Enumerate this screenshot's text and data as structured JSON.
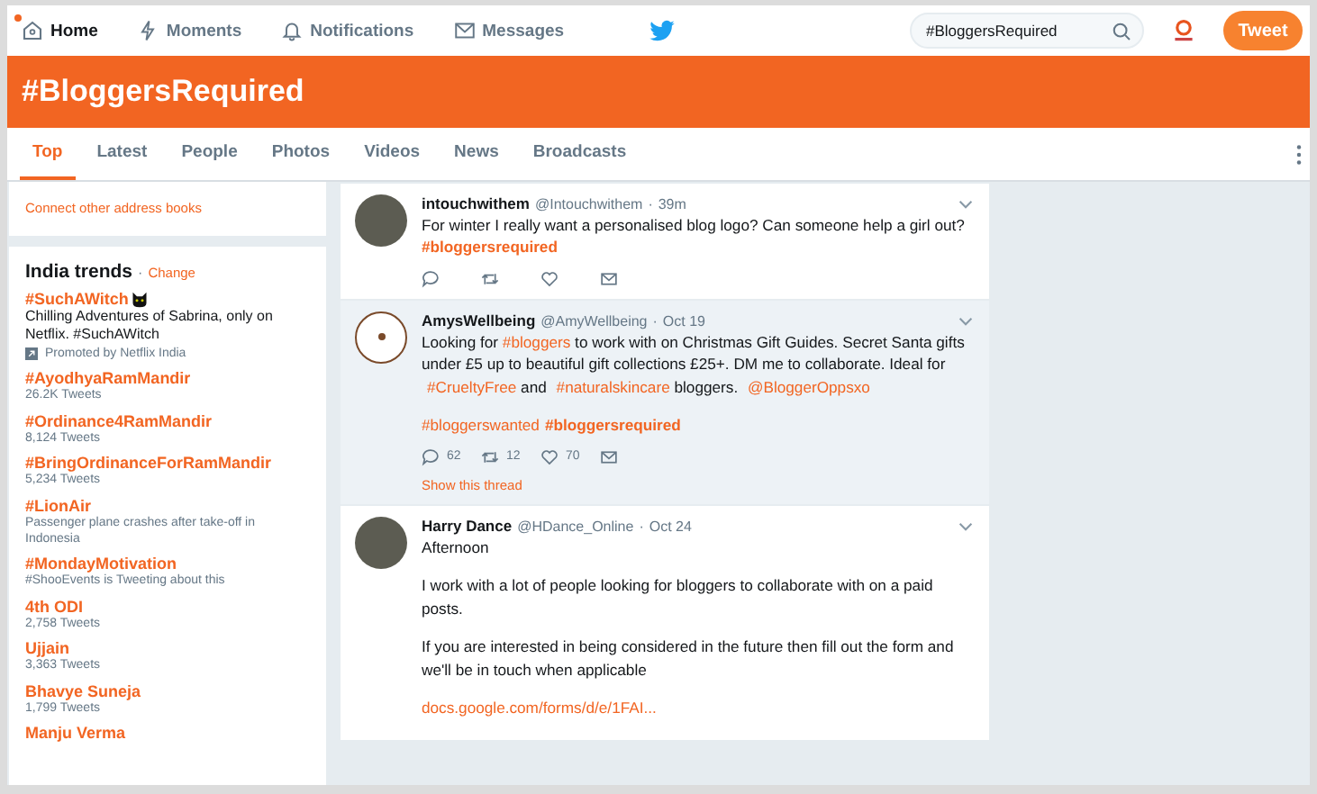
{
  "nav": {
    "items": [
      {
        "label": "Home",
        "selected": true,
        "dot": true
      },
      {
        "label": "Moments",
        "selected": false,
        "dot": false
      },
      {
        "label": "Notifications",
        "selected": false,
        "dot": false
      },
      {
        "label": "Messages",
        "selected": false,
        "dot": false
      }
    ],
    "search": {
      "value": "#BloggersRequired"
    },
    "tweet_button": "Tweet"
  },
  "banner": {
    "title": "#BloggersRequired"
  },
  "tabs": [
    {
      "label": "Top",
      "selected": true
    },
    {
      "label": "Latest",
      "selected": false
    },
    {
      "label": "People",
      "selected": false
    },
    {
      "label": "Photos",
      "selected": false
    },
    {
      "label": "Videos",
      "selected": false
    },
    {
      "label": "News",
      "selected": false
    },
    {
      "label": "Broadcasts",
      "selected": false
    }
  ],
  "sidebar": {
    "connect_link": "Connect other address books",
    "trends_title": "India trends",
    "separator": "·",
    "change_link": "Change",
    "trends": [
      {
        "kind": "promoted",
        "name": "#SuchAWitch",
        "description": "Chilling Adventures of Sabrina, only on Netflix. #SuchAWitch",
        "meta": "Promoted by Netflix India"
      },
      {
        "kind": "count",
        "name": "#AyodhyaRamMandir",
        "meta": "26.2K Tweets"
      },
      {
        "kind": "count",
        "name": "#Ordinance4RamMandir",
        "meta": "8,124 Tweets"
      },
      {
        "kind": "count",
        "name": "#BringOrdinanceForRamMandir",
        "meta": "5,234 Tweets"
      },
      {
        "kind": "count",
        "name": "#LionAir",
        "meta": "Passenger plane crashes after take-off in Indonesia"
      },
      {
        "kind": "count",
        "name": "#MondayMotivation",
        "meta": "#ShooEvents is Tweeting about this"
      },
      {
        "kind": "count",
        "name": "4th ODI",
        "meta": "2,758 Tweets"
      },
      {
        "kind": "count",
        "name": "Ujjain",
        "meta": "3,363 Tweets"
      },
      {
        "kind": "count",
        "name": "Bhavye Suneja",
        "meta": "1,799 Tweets"
      },
      {
        "kind": "count",
        "name": "Manju Verma"
      }
    ]
  },
  "tweets": [
    {
      "name": "intouchwithem",
      "handle": "@Intouchwithem",
      "separator": "·",
      "time": "39m",
      "highlighted": false,
      "paragraphs": [
        [
          {
            "kind": "plain",
            "text": "For winter I really want a personalised blog logo? Can someone help a girl out? "
          },
          {
            "kind": "strong-link",
            "text": "#bloggersrequired"
          }
        ]
      ],
      "show_actions": true
    },
    {
      "name": "AmysWellbeing",
      "handle": "@AmyWellbeing",
      "separator": "·",
      "time": "Oct 19",
      "highlighted": true,
      "paragraphs": [
        [
          {
            "kind": "plain",
            "text": "Looking for "
          },
          {
            "kind": "link",
            "text": "#bloggers"
          },
          {
            "kind": "plain",
            "text": " to work with on Christmas Gift Guides. Secret Santa gifts under £5 up to beautiful gift collections £25+.  DM me to collaborate. Ideal for "
          },
          {
            "kind": "link",
            "text": "#CrueltyFree"
          },
          {
            "kind": "plain",
            "text": " and "
          },
          {
            "kind": "link",
            "text": "#naturalskincare"
          },
          {
            "kind": "plain",
            "text": " bloggers. "
          },
          {
            "kind": "link",
            "text": "@BloggerOppsxo"
          }
        ],
        [
          {
            "kind": "link",
            "text": "#bloggerswanted"
          },
          {
            "kind": "strong-link",
            "text": "#bloggersrequired"
          }
        ]
      ],
      "show_actions": true,
      "actions": {
        "replies": "62",
        "retweets": "12",
        "likes": "70"
      },
      "thread_link": "Show this thread"
    },
    {
      "name": "Harry Dance",
      "handle": "@HDance_Online",
      "separator": "·",
      "time": "Oct 24",
      "highlighted": false,
      "paragraphs": [
        [
          {
            "kind": "plain",
            "text": "Afternoon"
          }
        ],
        [
          {
            "kind": "plain",
            "text": "I work with a lot of people looking for bloggers to collaborate with on a paid posts."
          }
        ],
        [
          {
            "kind": "plain",
            "text": "If you are interested in being considered in the future then  fill out the form and we'll be in touch when applicable"
          }
        ],
        [
          {
            "kind": "link",
            "text": "docs.google.com/forms/d/e/1FAI..."
          }
        ]
      ]
    }
  ]
}
